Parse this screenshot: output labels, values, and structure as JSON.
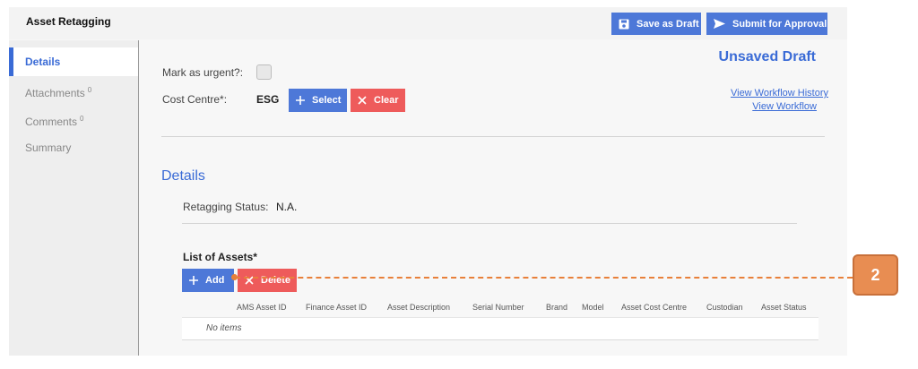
{
  "header": {
    "title": "Asset Retagging",
    "save_draft_label": "Save as Draft",
    "submit_label": "Submit for Approval"
  },
  "sidebar": {
    "items": [
      {
        "label": "Details",
        "count": ""
      },
      {
        "label": "Attachments",
        "count": "0"
      },
      {
        "label": "Comments",
        "count": "0"
      },
      {
        "label": "Summary",
        "count": ""
      }
    ]
  },
  "form": {
    "urgent_label": "Mark as urgent?:",
    "cost_centre_label": "Cost Centre*:",
    "cost_centre_value": "ESG",
    "select_label": "Select",
    "clear_label": "Clear"
  },
  "status": {
    "draft_title": "Unsaved Draft",
    "workflow_history_link": "View Workflow History",
    "workflow_link": "View Workflow"
  },
  "details": {
    "section_title": "Details",
    "retagging_status_label": "Retagging Status:",
    "retagging_status_value": "N.A."
  },
  "assets": {
    "list_title": "List of Assets*",
    "add_label": "Add",
    "delete_label": "Delete",
    "columns": [
      "AMS Asset ID",
      "Finance Asset ID",
      "Asset Description",
      "Serial Number",
      "Brand",
      "Model",
      "Asset Cost Centre",
      "Custodian",
      "Asset Status"
    ],
    "empty_text": "No items"
  },
  "annotation": {
    "callout_number": "2"
  },
  "colors": {
    "primary": "#4d78d8",
    "danger": "#ee5b5b",
    "accent_text": "#3a6bd6",
    "callout": "#e88d52"
  }
}
